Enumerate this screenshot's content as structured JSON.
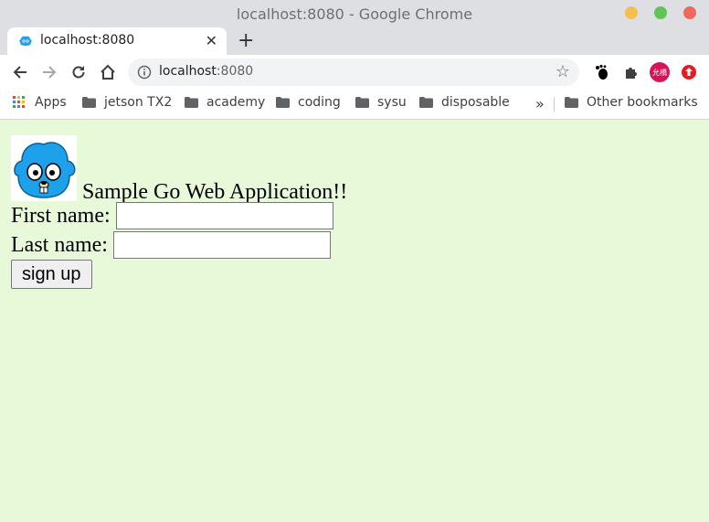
{
  "window": {
    "title": "localhost:8080 - Google Chrome",
    "controls": [
      {
        "name": "minimize",
        "color": "#f5bf4f"
      },
      {
        "name": "maximize",
        "color": "#61c554"
      },
      {
        "name": "close",
        "color": "#ed6a5e"
      }
    ]
  },
  "tab": {
    "title": "localhost:8080",
    "close_glyph": "✕"
  },
  "new_tab_glyph": "+",
  "toolbar": {
    "url_host": "localhost",
    "url_port": ":8080",
    "star_glyph": "☆",
    "profile_avatar_text": "允橋",
    "avatar_color": "#d6145a",
    "extension_update_color": "#e31b23"
  },
  "bookmarks": {
    "apps_label": "Apps",
    "items": [
      "jetson TX2",
      "academy",
      "coding",
      "sysu",
      "disposable"
    ],
    "overflow": "»",
    "other": "Other bookmarks"
  },
  "page": {
    "heading": "Sample Go Web Application!!",
    "first_name_label": "First name:",
    "first_name_value": "",
    "last_name_label": "Last name:",
    "last_name_value": "",
    "submit_label": "sign up",
    "background": "#e8f9d9"
  }
}
